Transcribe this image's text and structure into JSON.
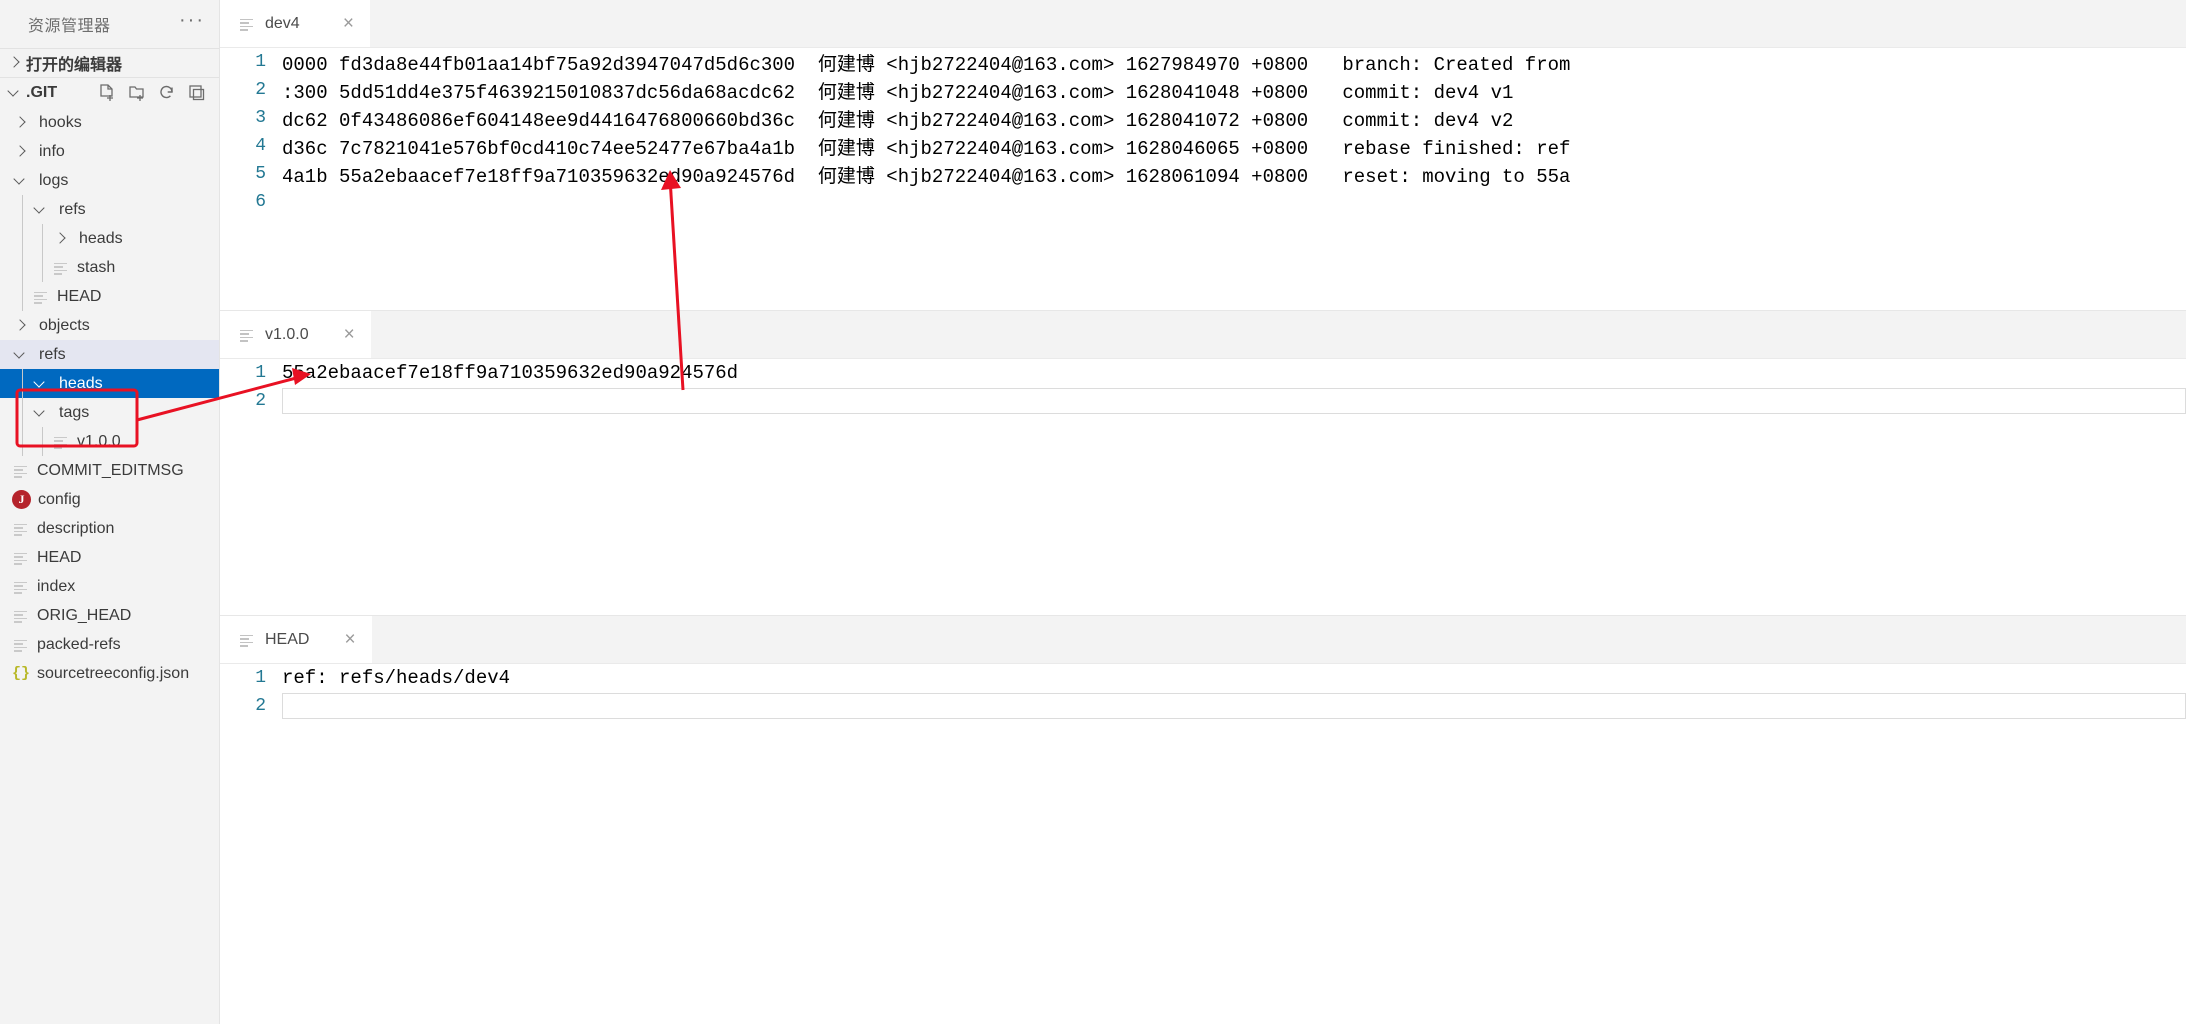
{
  "sidebar": {
    "title": "资源管理器",
    "more_label": "···",
    "open_editors": {
      "label": "打开的编辑器",
      "icon": "chevron-right-icon"
    },
    "root": {
      "label": ".GIT",
      "actions": [
        "new-file-icon",
        "new-folder-icon",
        "refresh-icon",
        "collapse-all-icon"
      ]
    },
    "items": [
      {
        "label": "hooks",
        "depth": 1,
        "type": "folder",
        "expanded": false,
        "state": "normal"
      },
      {
        "label": "info",
        "depth": 1,
        "type": "folder",
        "expanded": false,
        "state": "normal"
      },
      {
        "label": "logs",
        "depth": 1,
        "type": "folder",
        "expanded": true,
        "state": "normal"
      },
      {
        "label": "refs",
        "depth": 2,
        "type": "folder",
        "expanded": true,
        "state": "normal"
      },
      {
        "label": "heads",
        "depth": 3,
        "type": "folder",
        "expanded": false,
        "state": "normal"
      },
      {
        "label": "stash",
        "depth": 3,
        "type": "file",
        "state": "normal"
      },
      {
        "label": "HEAD",
        "depth": 2,
        "type": "file",
        "state": "normal"
      },
      {
        "label": "objects",
        "depth": 1,
        "type": "folder",
        "expanded": false,
        "state": "normal"
      },
      {
        "label": "refs",
        "depth": 1,
        "type": "folder",
        "expanded": true,
        "state": "hover"
      },
      {
        "label": "heads",
        "depth": 2,
        "type": "folder",
        "expanded": true,
        "state": "selected"
      },
      {
        "label": "tags",
        "depth": 2,
        "type": "folder",
        "expanded": true,
        "state": "normal"
      },
      {
        "label": "v1.0.0",
        "depth": 3,
        "type": "file",
        "state": "normal"
      },
      {
        "label": "COMMIT_EDITMSG",
        "depth": 1,
        "type": "file",
        "state": "normal"
      },
      {
        "label": "config",
        "depth": 1,
        "type": "config",
        "state": "normal"
      },
      {
        "label": "description",
        "depth": 1,
        "type": "file",
        "state": "normal"
      },
      {
        "label": "HEAD",
        "depth": 1,
        "type": "file",
        "state": "normal"
      },
      {
        "label": "index",
        "depth": 1,
        "type": "file",
        "state": "normal"
      },
      {
        "label": "ORIG_HEAD",
        "depth": 1,
        "type": "file",
        "state": "normal"
      },
      {
        "label": "packed-refs",
        "depth": 1,
        "type": "file",
        "state": "normal"
      },
      {
        "label": "sourcetreeconfig.json",
        "depth": 1,
        "type": "json",
        "state": "normal"
      }
    ]
  },
  "panes": [
    {
      "tab": {
        "label": "dev4",
        "close": "×",
        "icon": "file-icon"
      },
      "lines": [
        {
          "n": "1",
          "text": "0000 fd3da8e44fb01aa14bf75a92d3947047d5d6c300  何建博 <hjb2722404@163.com> 1627984970 +0800   branch: Created from"
        },
        {
          "n": "2",
          "text": ":300 5dd51dd4e375f4639215010837dc56da68acdc62  何建博 <hjb2722404@163.com> 1628041048 +0800   commit: dev4 v1"
        },
        {
          "n": "3",
          "text": "dc62 0f43486086ef604148ee9d4416476800660bd36c  何建博 <hjb2722404@163.com> 1628041072 +0800   commit: dev4 v2"
        },
        {
          "n": "4",
          "text": "d36c 7c7821041e576bf0cd410c74ee52477e67ba4a1b  何建博 <hjb2722404@163.com> 1628046065 +0800   rebase finished: ref"
        },
        {
          "n": "5",
          "text": "4a1b 55a2ebaacef7e18ff9a710359632ed90a924576d  何建博 <hjb2722404@163.com> 1628061094 +0800   reset: moving to 55a"
        },
        {
          "n": "6",
          "text": ""
        }
      ]
    },
    {
      "tab": {
        "label": "v1.0.0",
        "close": "×",
        "icon": "file-icon"
      },
      "lines": [
        {
          "n": "1",
          "text": "55a2ebaacef7e18ff9a710359632ed90a924576d"
        },
        {
          "n": "2",
          "text": ""
        }
      ]
    },
    {
      "tab": {
        "label": "HEAD",
        "close": "×",
        "icon": "file-icon"
      },
      "lines": [
        {
          "n": "1",
          "text": "ref: refs/heads/dev4"
        },
        {
          "n": "2",
          "text": ""
        }
      ]
    }
  ],
  "annotations": {
    "box_color": "#e81123",
    "arrow_color": "#e81123",
    "highlight_target": "tags / v1.0.0",
    "arrow1_desc": "arrow from v1.0.0 file content up to dev4 commit hash",
    "arrow2_desc": "arrow from tags/v1.0.0 tree node to v1.0.0 editor content"
  },
  "colors": {
    "selection_blue": "#0069c0",
    "gutter_blue": "#237893",
    "sidebar_bg": "#f3f3f3",
    "editor_bg": "#ffffff"
  }
}
